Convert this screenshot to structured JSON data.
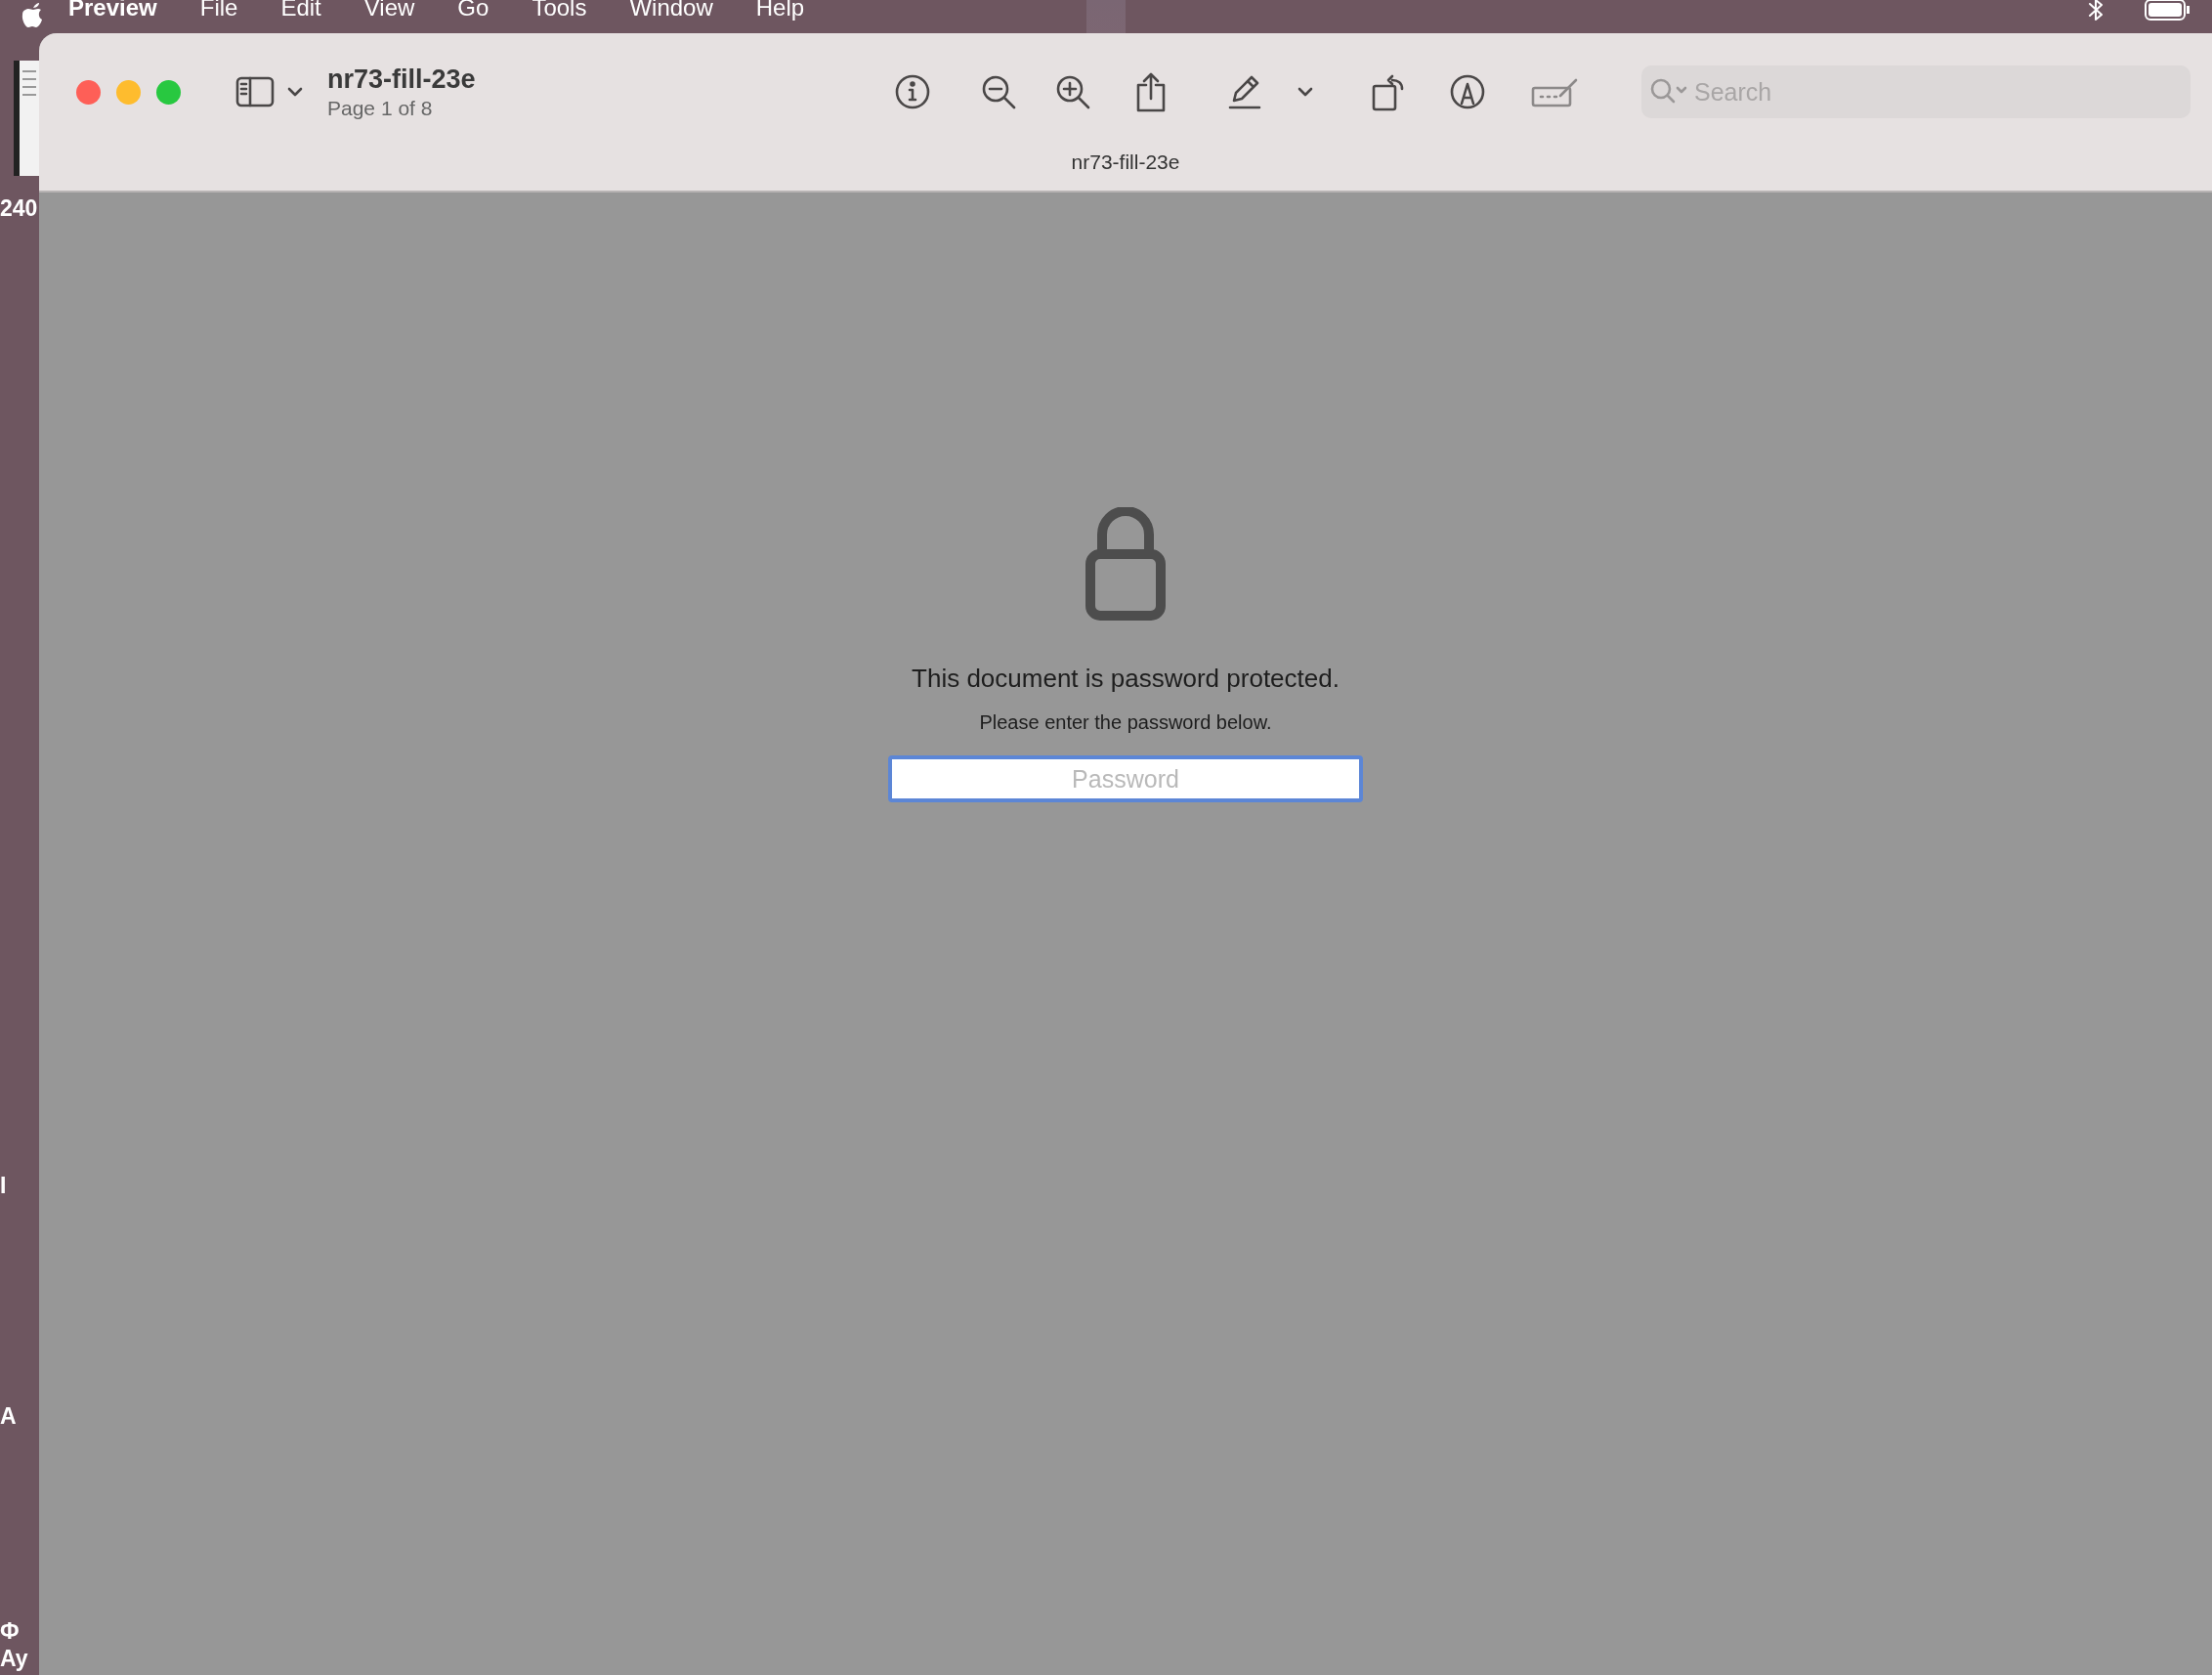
{
  "menu_bar": {
    "app_name": "Preview",
    "menus": [
      "File",
      "Edit",
      "View",
      "Go",
      "Tools",
      "Window",
      "Help"
    ]
  },
  "desktop": {
    "labels": [
      "240",
      "I",
      "A",
      "Ф",
      "Ay"
    ]
  },
  "window": {
    "title": "nr73-fill-23e",
    "subtitle": "Page 1 of 8",
    "document_name": "nr73-fill-23e",
    "search": {
      "placeholder": "Search"
    },
    "lock_screen": {
      "heading": "This document is password protected.",
      "message": "Please enter the password below.",
      "password_field": {
        "placeholder": "Password",
        "focused": true
      }
    }
  }
}
